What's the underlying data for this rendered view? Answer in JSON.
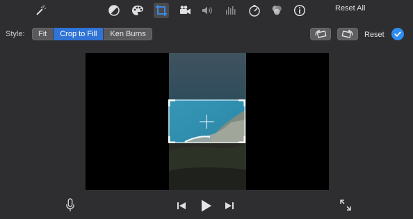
{
  "toolbar": {
    "tools": [
      {
        "name": "magic-wand-icon"
      },
      {
        "name": "color-balance-icon"
      },
      {
        "name": "color-correction-icon"
      },
      {
        "name": "crop-icon",
        "active": true
      },
      {
        "name": "stabilization-camera-icon"
      },
      {
        "name": "volume-icon"
      },
      {
        "name": "equalizer-icon"
      },
      {
        "name": "speed-icon"
      },
      {
        "name": "clip-filter-icon"
      },
      {
        "name": "info-icon"
      }
    ],
    "reset_all_label": "Reset All"
  },
  "style": {
    "label": "Style:",
    "options": [
      "Fit",
      "Crop to Fill",
      "Ken Burns"
    ],
    "selected": "Crop to Fill",
    "reset_label": "Reset"
  },
  "colors": {
    "accent": "#2f74d6",
    "background": "#2e2d2f",
    "check": "#2f8cf0"
  },
  "playback": {
    "icons": [
      "microphone-icon",
      "skip-back-icon",
      "play-icon",
      "skip-forward-icon",
      "fullscreen-icon"
    ]
  }
}
